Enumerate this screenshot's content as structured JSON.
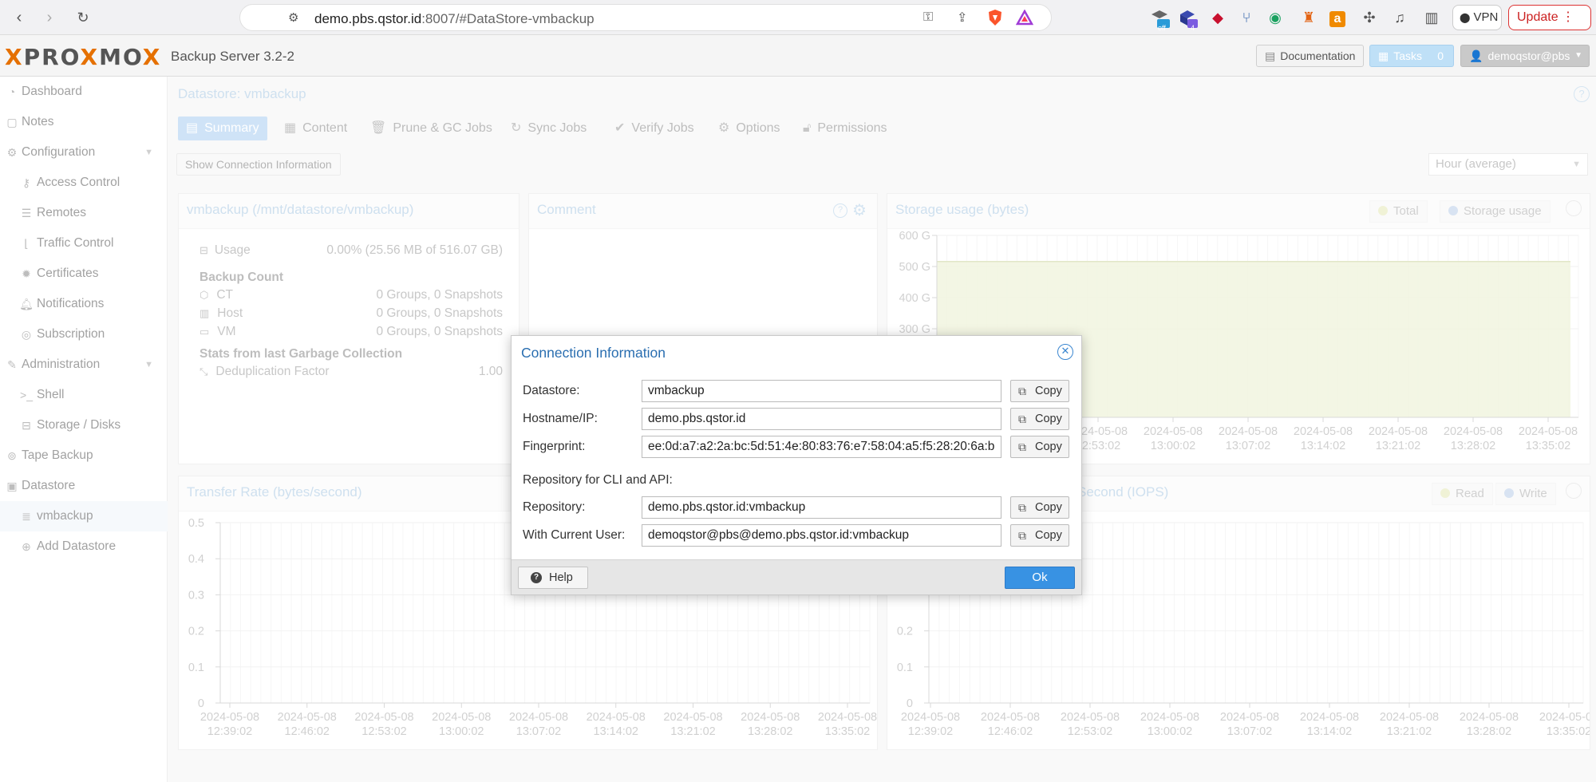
{
  "browser": {
    "url_host": "demo.pbs.qstor.id",
    "url_rest": ":8007/#DataStore-vmbackup",
    "vpn_label": "VPN",
    "update_label": "Update",
    "ext_badge_off": "off",
    "ext_badge_count": "4"
  },
  "header": {
    "logo_left": "PRO",
    "logo_x": "X",
    "logo_mid": "MO",
    "logo_right": "X",
    "product": "Backup Server 3.2-2",
    "documentation": "Documentation",
    "tasks": "Tasks",
    "tasks_count": "0",
    "user": "demoqstor@pbs"
  },
  "sidebar": {
    "items": [
      {
        "label": "Dashboard",
        "icon": "dashboard-icon"
      },
      {
        "label": "Notes",
        "icon": "notes-icon"
      },
      {
        "label": "Configuration",
        "icon": "gears-icon"
      },
      {
        "label": "Access Control",
        "icon": "key-icon"
      },
      {
        "label": "Remotes",
        "icon": "server-icon"
      },
      {
        "label": "Traffic Control",
        "icon": "chart-icon"
      },
      {
        "label": "Certificates",
        "icon": "certificate-icon"
      },
      {
        "label": "Notifications",
        "icon": "bell-icon"
      },
      {
        "label": "Subscription",
        "icon": "support-icon"
      },
      {
        "label": "Administration",
        "icon": "wrench-icon"
      },
      {
        "label": "Shell",
        "icon": "terminal-icon"
      },
      {
        "label": "Storage / Disks",
        "icon": "hdd-icon"
      },
      {
        "label": "Tape Backup",
        "icon": "tape-icon"
      },
      {
        "label": "Datastore",
        "icon": "archive-icon"
      },
      {
        "label": "vmbackup",
        "icon": "database-icon"
      },
      {
        "label": "Add Datastore",
        "icon": "plus-circle-icon"
      }
    ]
  },
  "main": {
    "title": "Datastore: vmbackup",
    "tabs": [
      "Summary",
      "Content",
      "Prune & GC Jobs",
      "Sync Jobs",
      "Verify Jobs",
      "Options",
      "Permissions"
    ],
    "show_conn_btn": "Show Connection Information",
    "timeframe": "Hour (average)"
  },
  "summary_panel": {
    "title": "vmbackup (/mnt/datastore/vmbackup)",
    "usage_label": "Usage",
    "usage_value": "0.00% (25.56 MB of 516.07 GB)",
    "backup_count_h": "Backup Count",
    "ct_label": "CT",
    "ct_value": "0 Groups, 0 Snapshots",
    "host_label": "Host",
    "host_value": "0 Groups, 0 Snapshots",
    "vm_label": "VM",
    "vm_value": "0 Groups, 0 Snapshots",
    "gc_h": "Stats from last Garbage Collection",
    "dedup_label": "Deduplication Factor",
    "dedup_value": "1.00"
  },
  "comment_panel": {
    "title": "Comment"
  },
  "storage_panel": {
    "title": "Storage usage (bytes)",
    "legend_total": "Total",
    "legend_usage": "Storage usage"
  },
  "transfer_panel": {
    "title": "Transfer Rate (bytes/second)"
  },
  "iops_panel": {
    "title_visible": "Second (IOPS)",
    "legend_read": "Read",
    "legend_write": "Write"
  },
  "chart_data": [
    {
      "type": "area",
      "title": "Storage usage (bytes)",
      "y_ticks": [
        "600 G",
        "500 G",
        "400 G",
        "300 G"
      ],
      "ylim": [
        0,
        600
      ],
      "x_ticks_visible": [
        "2024-05-08 12:53:02",
        "2024-05-08 13:00:02",
        "2024-05-08 13:07:02",
        "2024-05-08 13:14:02",
        "2024-05-08 13:21:02",
        "2024-05-08 13:28:02",
        "2024-05-08 13:35:02"
      ],
      "series": [
        {
          "name": "Total",
          "values": [
            516.07,
            516.07
          ]
        },
        {
          "name": "Storage usage",
          "values": [
            0.02556,
            0.02556
          ]
        }
      ],
      "legend": "top-right",
      "colors": {
        "total_fill": "#e6ecc6",
        "total_line": "#c8d49a"
      }
    },
    {
      "type": "line",
      "title": "Transfer Rate (bytes/second)",
      "y_ticks": [
        "0.5",
        "0.4",
        "0.3",
        "0.2",
        "0.1",
        "0"
      ],
      "ylim": [
        0,
        0.5
      ],
      "x_ticks": [
        "2024-05-08 12:39:02",
        "2024-05-08 12:46:02",
        "2024-05-08 12:53:02",
        "2024-05-08 13:00:02",
        "2024-05-08 13:07:02",
        "2024-05-08 13:14:02",
        "2024-05-08 13:21:02",
        "2024-05-08 13:28:02",
        "2024-05-08 13:35:02"
      ]
    },
    {
      "type": "line",
      "title": "Second (IOPS)",
      "y_ticks": [
        "0.2",
        "0.1",
        "0"
      ],
      "ylim": [
        0,
        0.5
      ],
      "x_ticks": [
        "2024-05-08 12:39:02",
        "2024-05-08 12:46:02",
        "2024-05-08 12:53:02",
        "2024-05-08 13:00:02",
        "2024-05-08 13:07:02",
        "2024-05-08 13:14:02",
        "2024-05-08 13:21:02",
        "2024-05-08 13:28:02",
        "2024-05-08 13:35:02"
      ],
      "legend": "top-right"
    }
  ],
  "dialog": {
    "title": "Connection Information",
    "datastore_label": "Datastore:",
    "datastore_value": "vmbackup",
    "hostname_label": "Hostname/IP:",
    "hostname_value": "demo.pbs.qstor.id",
    "fingerprint_label": "Fingerprint:",
    "fingerprint_value": "ee:0d:a7:a2:2a:bc:5d:51:4e:80:83:76:e7:58:04:a5:f5:28:20:6a:b",
    "repo_heading": "Repository for CLI and API:",
    "repository_label": "Repository:",
    "repository_value": "demo.pbs.qstor.id:vmbackup",
    "current_user_label": "With Current User:",
    "current_user_value": "demoqstor@pbs@demo.pbs.qstor.id:vmbackup",
    "copy_label": "Copy",
    "help_label": "Help",
    "ok_label": "Ok"
  }
}
